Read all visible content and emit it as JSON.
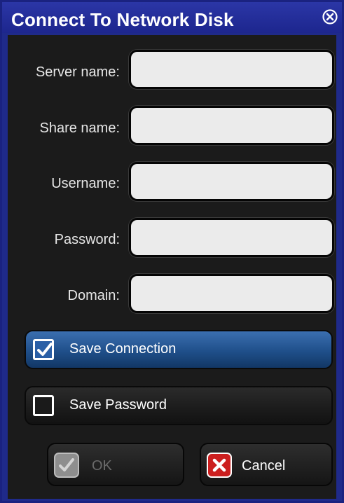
{
  "window": {
    "title": "Connect To Network Disk"
  },
  "fields": [
    {
      "key": "server",
      "label": "Server name:",
      "value": "",
      "placeholder": ""
    },
    {
      "key": "share",
      "label": "Share name:",
      "value": "",
      "placeholder": ""
    },
    {
      "key": "username",
      "label": "Username:",
      "value": "",
      "placeholder": ""
    },
    {
      "key": "password",
      "label": "Password:",
      "value": "",
      "placeholder": ""
    },
    {
      "key": "domain",
      "label": "Domain:",
      "value": "",
      "placeholder": ""
    }
  ],
  "options": {
    "save_connection": {
      "label": "Save Connection",
      "checked": true
    },
    "save_password": {
      "label": "Save Password",
      "checked": false
    }
  },
  "buttons": {
    "ok": {
      "label": "OK",
      "enabled": false
    },
    "cancel": {
      "label": "Cancel",
      "enabled": true
    }
  },
  "icons": {
    "close": "close-circle-icon",
    "ok": "checkmark-icon",
    "cancel": "x-icon",
    "checkbox_checked": "checkmark-icon"
  },
  "colors": {
    "title_bar": "#1f2a8a",
    "panel": "#1b1b1b",
    "selected_row": "#2a5fa6",
    "cancel_icon": "#cc1f1f",
    "disabled_text": "#6a6a6a"
  }
}
